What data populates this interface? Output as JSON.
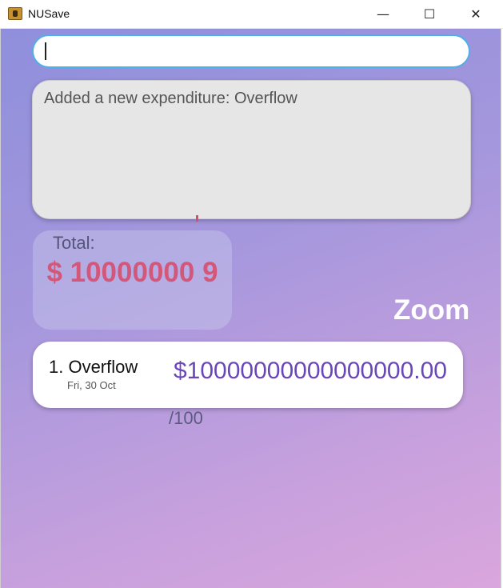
{
  "window": {
    "title": "NUSave",
    "controls": {
      "minimize": "—",
      "maximize": "☐",
      "close": "✕"
    },
    "app_icon": "address-book-icon"
  },
  "command_box": {
    "value": ""
  },
  "result_display": {
    "message": "Added a new expenditure: Overflow"
  },
  "total": {
    "label": "Total:",
    "value": "$ 10000000 9"
  },
  "zoom": {
    "label": "Zoom"
  },
  "expenditures": [
    {
      "index_name": "1. Overflow",
      "date": "Fri, 30 Oct",
      "amount": "$10000000000000000.00"
    }
  ],
  "budget": {
    "denominator": "/100"
  },
  "colors": {
    "accent_purple": "#6a47b8",
    "total_red": "#d2577b",
    "input_border": "#4fb0e8"
  }
}
